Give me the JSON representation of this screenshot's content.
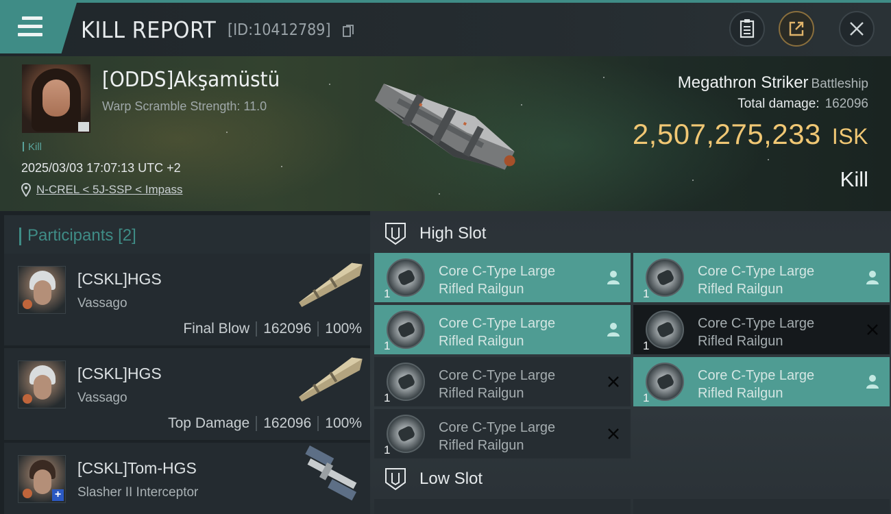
{
  "header": {
    "title": "KILL REPORT",
    "report_id": "[ID:10412789]"
  },
  "victim": {
    "name": "[ODDS]Akşamüstü",
    "warp_scramble": "Warp Scramble Strength: 11.0",
    "tag": "Kill",
    "datetime": "2025/03/03 17:07:13 UTC +2",
    "location": "N-CREL < 5J-SSP < Impass",
    "ship_name": "Megathron Striker",
    "ship_class": "Battleship",
    "total_damage_label": "Total damage:",
    "total_damage": "162096",
    "isk_value": "2,507,275,233",
    "isk_unit": "ISK",
    "result": "Kill"
  },
  "participants": {
    "title": "Participants",
    "count": "[2]",
    "items": [
      {
        "name": "[CSKL]HGS",
        "ship": "Vassago",
        "role": "Final Blow",
        "damage": "162096",
        "percent": "100%"
      },
      {
        "name": "[CSKL]HGS",
        "ship": "Vassago",
        "role": "Top Damage",
        "damage": "162096",
        "percent": "100%"
      },
      {
        "name": "[CSKL]Tom-HGS",
        "ship": "Slasher II Interceptor"
      }
    ]
  },
  "fitting": {
    "high_slot_title": "High Slot",
    "low_slot_title": "Low Slot",
    "high_modules": [
      {
        "line1": "Core C-Type Large",
        "line2": "Rifled Railgun",
        "qty": "1",
        "status": "dropped"
      },
      {
        "line1": "Core C-Type Large",
        "line2": "Rifled Railgun",
        "qty": "1",
        "status": "dropped"
      },
      {
        "line1": "Core C-Type Large",
        "line2": "Rifled Railgun",
        "qty": "1",
        "status": "dropped"
      },
      {
        "line1": "Core C-Type Large",
        "line2": "Rifled Railgun",
        "qty": "1",
        "status": "destroyed"
      },
      {
        "line1": "Core C-Type Large",
        "line2": "Rifled Railgun",
        "qty": "1",
        "status": "destroyed"
      },
      {
        "line1": "Core C-Type Large",
        "line2": "Rifled Railgun",
        "qty": "1",
        "status": "dropped"
      },
      {
        "line1": "Core C-Type Large",
        "line2": "Rifled Railgun",
        "qty": "1",
        "status": "destroyed"
      }
    ]
  },
  "colors": {
    "accent": "#3f8c86",
    "isk": "#f0c774",
    "module_on": "#4f9c93"
  },
  "icons": [
    "menu-icon",
    "copy-icon",
    "clipboard-icon",
    "share-icon",
    "close-icon",
    "location-pin-icon",
    "shield-slot-icon",
    "person-icon",
    "x-mark-icon"
  ]
}
